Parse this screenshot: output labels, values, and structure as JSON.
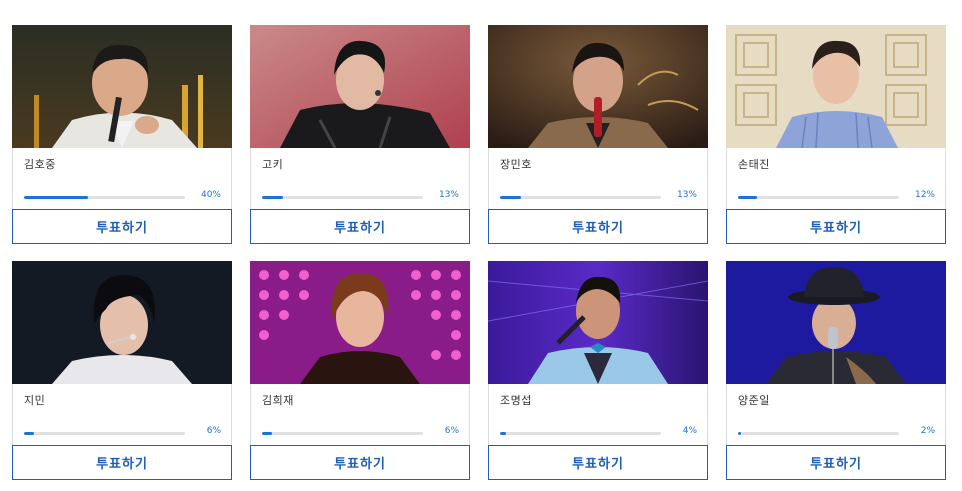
{
  "vote_label": "투표하기",
  "accent_color": "#1a73d9",
  "candidates": [
    {
      "name": "김호중",
      "percent_label": "40%",
      "progress": 0.4,
      "photo": "singer-in-white-suit-with-mic"
    },
    {
      "name": "고키",
      "percent_label": "13%",
      "progress": 0.13,
      "photo": "dancer-in-black-leather"
    },
    {
      "name": "장민호",
      "percent_label": "13%",
      "progress": 0.13,
      "photo": "singer-in-suit-with-red-mic"
    },
    {
      "name": "손태진",
      "percent_label": "12%",
      "progress": 0.12,
      "photo": "man-in-striped-shirt"
    },
    {
      "name": "지민",
      "percent_label": "6%",
      "progress": 0.06,
      "photo": "idol-with-headset-mic"
    },
    {
      "name": "김희재",
      "percent_label": "6%",
      "progress": 0.06,
      "photo": "singer-on-purple-stage"
    },
    {
      "name": "조명섭",
      "percent_label": "4%",
      "progress": 0.04,
      "photo": "singer-in-light-blue-suit"
    },
    {
      "name": "양준일",
      "percent_label": "2%",
      "progress": 0.02,
      "photo": "singer-in-hat-with-mic"
    }
  ]
}
